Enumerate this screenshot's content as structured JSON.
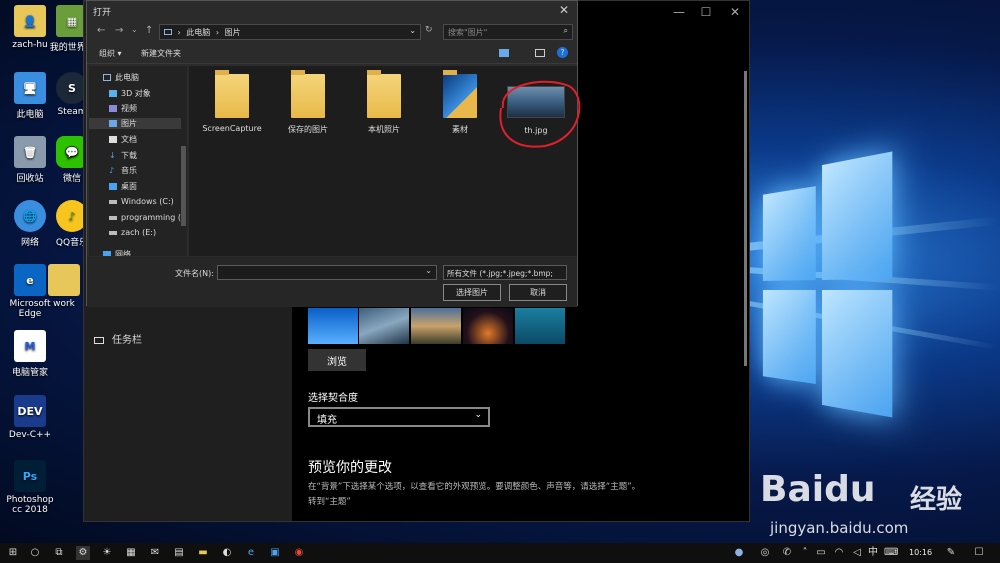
{
  "desktop": {
    "icons": [
      {
        "label": "zach-hu",
        "icon": "user-folder-icon",
        "color": "#e8c75a"
      },
      {
        "label": "我的世界...",
        "icon": "minecraft-icon",
        "color": "#6a9e3a"
      },
      {
        "label": "此电脑",
        "icon": "this-pc-icon",
        "color": "#3a8ee0"
      },
      {
        "label": "Steam",
        "icon": "steam-icon",
        "color": "#1b2838"
      },
      {
        "label": "回收站",
        "icon": "recycle-bin-icon",
        "color": "#9ab"
      },
      {
        "label": "微信",
        "icon": "wechat-icon",
        "color": "#2dc100"
      },
      {
        "label": "网络",
        "icon": "network-icon",
        "color": "#3a8ee0"
      },
      {
        "label": "QQ音乐",
        "icon": "qq-music-icon",
        "color": "#f7c51e"
      },
      {
        "label": "Microsoft Edge",
        "icon": "edge-icon",
        "color": "#0a66c2"
      },
      {
        "label": "work",
        "icon": "folder-icon",
        "color": "#e8c75a"
      },
      {
        "label": "电脑管家",
        "icon": "pc-manager-icon",
        "color": "#fff"
      },
      {
        "label": "Dev-C++",
        "icon": "devcpp-icon",
        "color": "#1a3b8c"
      },
      {
        "label": "Photoshop cc 2018",
        "icon": "photoshop-icon",
        "color": "#001e36"
      }
    ]
  },
  "settings": {
    "sidebar_item": "任务栏",
    "browse_label": "浏览",
    "fit_label": "选择契合度",
    "fit_value": "填充",
    "preview_title": "预览你的更改",
    "preview_desc": "在“背景”下选择某个选项，以查看它的外观预览。要调整颜色、声音等，请选择“主题”。",
    "theme_link": "转到“主题”"
  },
  "dialog": {
    "title": "打开",
    "breadcrumb": [
      "此电脑",
      "图片"
    ],
    "search_placeholder": "搜索\"图片\"",
    "organize": "组织 ▾",
    "new_folder": "新建文件夹",
    "tree": [
      {
        "label": "此电脑",
        "icon": "pc-icon"
      },
      {
        "label": "3D 对象",
        "icon": "cube-icon"
      },
      {
        "label": "视频",
        "icon": "video-icon"
      },
      {
        "label": "图片",
        "icon": "picture-icon"
      },
      {
        "label": "文档",
        "icon": "document-icon"
      },
      {
        "label": "下载",
        "icon": "download-icon"
      },
      {
        "label": "音乐",
        "icon": "music-icon"
      },
      {
        "label": "桌面",
        "icon": "desktop-icon"
      },
      {
        "label": "Windows (C:)",
        "icon": "drive-icon"
      },
      {
        "label": "programming (",
        "icon": "drive-icon"
      },
      {
        "label": "zach (E:)",
        "icon": "drive-icon"
      },
      {
        "label": "网络",
        "icon": "network-icon"
      }
    ],
    "files": [
      {
        "label": "ScreenCapture",
        "type": "folder"
      },
      {
        "label": "保存的图片",
        "type": "folder"
      },
      {
        "label": "本机照片",
        "type": "folder"
      },
      {
        "label": "素材",
        "type": "folder-image"
      },
      {
        "label": "th.jpg",
        "type": "image"
      }
    ],
    "filename_label": "文件名(N):",
    "filename_value": "",
    "filetype": "所有文件 (*.jpg;*.jpeg;*.bmp;",
    "open_button": "选择图片",
    "cancel_button": "取消"
  },
  "taskbar": {
    "time": "10:16",
    "ime": "中"
  },
  "watermark": {
    "brand": "Baidu",
    "product": "经验",
    "url": "jingyan.baidu.com"
  }
}
